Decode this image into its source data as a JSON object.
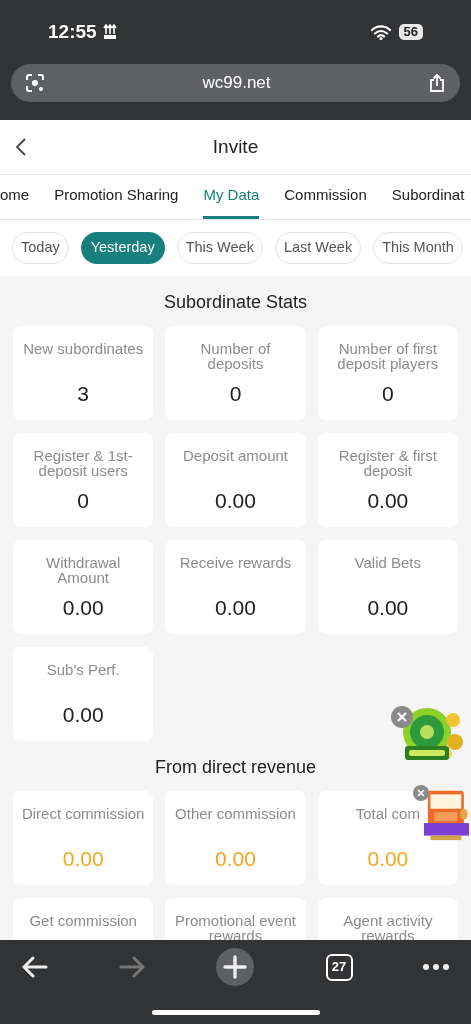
{
  "status_bar": {
    "time": "12:55",
    "battery": "56"
  },
  "browser": {
    "url": "wc99.net",
    "tab_count": "27"
  },
  "header": {
    "title": "Invite"
  },
  "tabs": [
    {
      "label": "ome",
      "selected": false
    },
    {
      "label": "Promotion Sharing",
      "selected": false
    },
    {
      "label": "My Data",
      "selected": true
    },
    {
      "label": "Commission",
      "selected": false
    },
    {
      "label": "Subordinat",
      "selected": false
    }
  ],
  "periods": [
    {
      "label": "Today",
      "selected": false
    },
    {
      "label": "Yesterday",
      "selected": true
    },
    {
      "label": "This Week",
      "selected": false
    },
    {
      "label": "Last Week",
      "selected": false
    },
    {
      "label": "This Month",
      "selected": false
    }
  ],
  "sections": [
    {
      "title": "Subordinate Stats",
      "kind": "plain",
      "cards": [
        {
          "label": "New subordinates",
          "value": "3"
        },
        {
          "label": "Number of deposits",
          "value": "0"
        },
        {
          "label": "Number of first deposit players",
          "value": "0"
        },
        {
          "label": "Register & 1st-deposit users",
          "value": "0"
        },
        {
          "label": "Deposit amount",
          "value": "0.00"
        },
        {
          "label": "Register & first deposit",
          "value": "0.00"
        },
        {
          "label": "Withdrawal Amount",
          "value": "0.00"
        },
        {
          "label": "Receive rewards",
          "value": "0.00"
        },
        {
          "label": "Valid Bets",
          "value": "0.00"
        },
        {
          "label": "Sub's Perf.",
          "value": "0.00"
        }
      ]
    },
    {
      "title": "From direct revenue",
      "kind": "highlight",
      "cards": [
        {
          "label": "Direct commission",
          "value": "0.00"
        },
        {
          "label": "Other commission",
          "value": "0.00"
        },
        {
          "label": "Total com",
          "value": "0.00"
        },
        {
          "label": "Get commission"
        },
        {
          "label": "Promotional event rewards"
        },
        {
          "label": "Agent activity rewards"
        }
      ]
    }
  ]
}
